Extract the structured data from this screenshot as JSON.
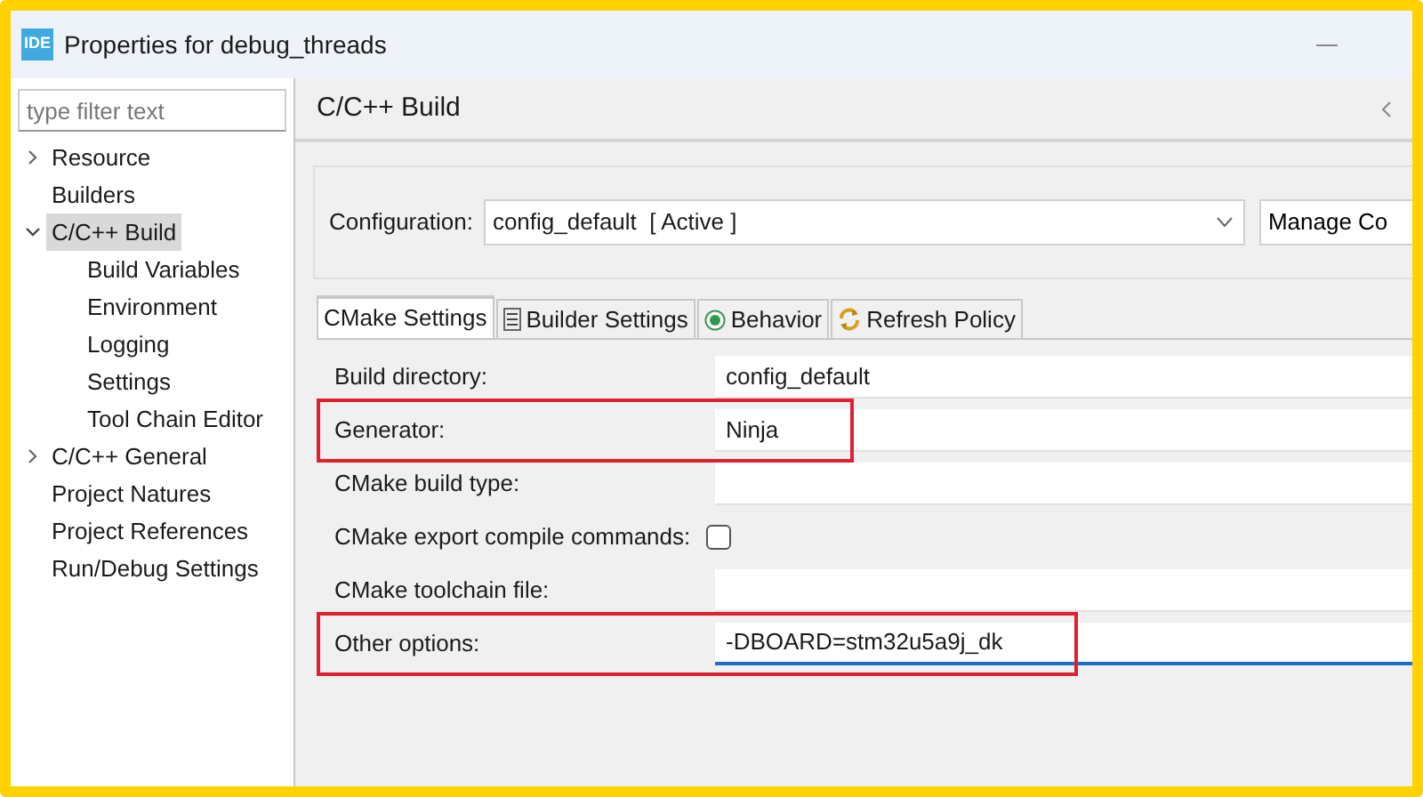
{
  "window": {
    "app_badge": "IDE",
    "title": "Properties for debug_threads"
  },
  "sidebar": {
    "filter": {
      "placeholder": "type filter text"
    },
    "items": [
      {
        "label": "Resource",
        "expanded": false,
        "selected": false
      },
      {
        "label": "Builders",
        "selected": false
      },
      {
        "label": "C/C++ Build",
        "expanded": true,
        "selected": true,
        "children": [
          {
            "label": "Build Variables",
            "selected": false
          },
          {
            "label": "Environment",
            "selected": false
          },
          {
            "label": "Logging",
            "selected": false
          },
          {
            "label": "Settings",
            "selected": false
          },
          {
            "label": "Tool Chain Editor",
            "selected": false
          }
        ]
      },
      {
        "label": "C/C++ General",
        "expanded": false,
        "selected": false
      },
      {
        "label": "Project Natures",
        "selected": false
      },
      {
        "label": "Project References",
        "selected": false
      },
      {
        "label": "Run/Debug Settings",
        "selected": false
      }
    ]
  },
  "page": {
    "title": "C/C++ Build",
    "configuration": {
      "label": "Configuration:",
      "value": "config_default  [ Active ]",
      "button": "Manage Co"
    },
    "tabs": [
      {
        "label": "CMake Settings",
        "kind": "plain",
        "selected": true
      },
      {
        "label": "Builder Settings",
        "kind": "list",
        "selected": false
      },
      {
        "label": "Behavior",
        "kind": "radio",
        "selected": false
      },
      {
        "label": "Refresh Policy",
        "kind": "refresh",
        "selected": false
      }
    ],
    "rows": [
      {
        "kind": "text",
        "label": "Build directory:",
        "value": "config_default",
        "highlighted": false,
        "focused": false
      },
      {
        "kind": "text",
        "label": "Generator:",
        "value": "Ninja",
        "highlighted": true,
        "focused": false
      },
      {
        "kind": "text",
        "label": "CMake build type:",
        "highlighted": false,
        "focused": false
      },
      {
        "kind": "checkbox",
        "label": "CMake export compile commands:",
        "checked": false,
        "highlighted": false
      },
      {
        "kind": "text",
        "label": "CMake toolchain file:",
        "highlighted": false,
        "focused": false
      },
      {
        "kind": "text",
        "label": "Other options:",
        "value": "-DBOARD=stm32u5a9j_dk",
        "highlighted": true,
        "focused": true
      }
    ]
  }
}
